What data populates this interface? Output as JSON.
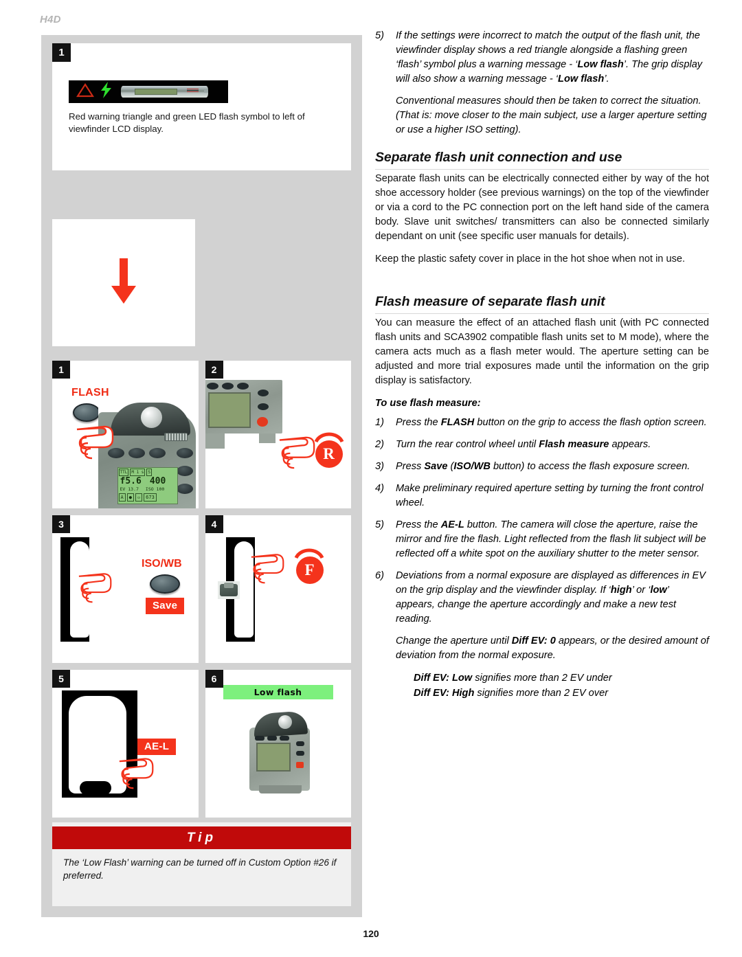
{
  "running_head": "H4D",
  "folio": "120",
  "colors": {
    "accent_red": "#f4331c",
    "tip_red": "#c00a0a",
    "panel_grey": "#d2d2d2",
    "lcd_green": "#7df07d",
    "led_green": "#2ee02e",
    "warning_triangle": "#cc2b16"
  },
  "left_column": {
    "viewfinder_card": {
      "badge": "1",
      "icons": {
        "triangle": "warning-triangle-icon",
        "bolt": "flash-bolt-icon",
        "lcd": "viewfinder-lcd-strip"
      },
      "caption": "Red warning triangle and green LED flash symbol to left of viewfinder LCD display."
    },
    "arrow_card": {
      "icon": "down-arrow-icon"
    },
    "steps": [
      {
        "badge": "1",
        "name": "step-press-flash-button",
        "label": "FLASH",
        "lcd": {
          "row_top": [
            "TTL",
            "M 1 s",
            "S"
          ],
          "aperture": "f5.6",
          "shutter": "400",
          "ev": "EV 13.7",
          "iso": "ISO 100",
          "row_bottom": [
            "A",
            "●",
            "▫",
            "673"
          ]
        }
      },
      {
        "badge": "2",
        "name": "step-turn-rear-wheel",
        "wheel": "R"
      },
      {
        "badge": "3",
        "name": "step-press-save-isowb",
        "label": "ISO/WB",
        "chip": "Save"
      },
      {
        "badge": "4",
        "name": "step-turn-front-wheel",
        "wheel": "F"
      },
      {
        "badge": "5",
        "name": "step-press-ael",
        "chip": "AE-L"
      },
      {
        "badge": "6",
        "name": "step-low-flash-result",
        "message": "Low flash"
      }
    ],
    "tip": {
      "heading": "Tip",
      "body": "The ‘Low Flash’ warning can be turned off in Custom Option #26 if preferred."
    }
  },
  "right_column": {
    "item5": {
      "number": "5)",
      "part1": "If the settings were incorrect to match the output of the flash unit, the viewfinder display shows a red triangle alongside a flashing green ‘flash’ symbol plus a warning message - ‘",
      "bold1": "Low flash",
      "part2": "’. The grip display will also show a warning message - ‘",
      "bold2": "Low flash",
      "part3": "’.",
      "continuation": "Conventional measures should then be taken to correct the situation. (That is: move closer to the main subject, use a larger aperture setting or use a higher ISO setting)."
    },
    "section1": {
      "heading": "Separate flash unit connection and use",
      "para1": "Separate flash units can be electrically connected either by way of the hot shoe accessory holder (see previous warnings) on the top of the viewfinder or via a cord to the PC connection port on the left hand side of the camera body. Slave unit switches/ transmitters can also be connected similarly dependant on unit (see specific user manuals for details).",
      "para2": "Keep the plastic safety cover in place in the hot shoe when not in use."
    },
    "section2": {
      "heading": "Flash measure of separate flash unit",
      "para1": "You can measure the effect of an attached flash unit (with PC connected flash units and SCA3902 compatible flash units set to M mode), where the camera acts much as a flash meter would. The aperture setting can be adjusted and more trial exposures made until the information on the grip display is satisfactory.",
      "subhead": "To use flash measure:",
      "steps": [
        {
          "number": "1)",
          "pre": "Press the ",
          "bold": "FLASH",
          "post": " button on the grip to access the flash option screen."
        },
        {
          "number": "2)",
          "pre": "Turn the rear control wheel until ",
          "bold": "Flash measure",
          "post": " appears."
        },
        {
          "number": "3)",
          "pre": "Press ",
          "bold": "Save",
          "mid": " (",
          "bold2": "ISO/WB",
          "post": " button) to access the flash exposure screen."
        },
        {
          "number": "4)",
          "pre": "Make preliminary required aperture setting by turning the front control wheel.",
          "bold": "",
          "post": ""
        },
        {
          "number": "5)",
          "pre": "Press the ",
          "bold": "AE-L",
          "post": " button. The camera will close the aperture, raise the mirror and fire the flash. Light reflected from the flash lit subject will be reflected off a white spot on the auxiliary shutter to the meter sensor."
        },
        {
          "number": "6)",
          "pre": "Deviations from a normal exposure are displayed as differences in EV on the grip display and the viewfinder display. If ‘",
          "bold": "high",
          "mid": "’ or ‘",
          "bold2": "low",
          "post": "’ appears, change the aperture accordingly and make a new test reading."
        }
      ],
      "closing": {
        "pre": "Change the aperture until ",
        "bold": "Diff EV: 0",
        "post": " appears, or the desired amount of deviation from the normal exposure."
      },
      "diff_ev": [
        {
          "bold": "Diff EV: Low",
          "rest": " signifies more than 2 EV under"
        },
        {
          "bold": "Diff EV: High",
          "rest": " signifies more than 2 EV over"
        }
      ]
    }
  }
}
